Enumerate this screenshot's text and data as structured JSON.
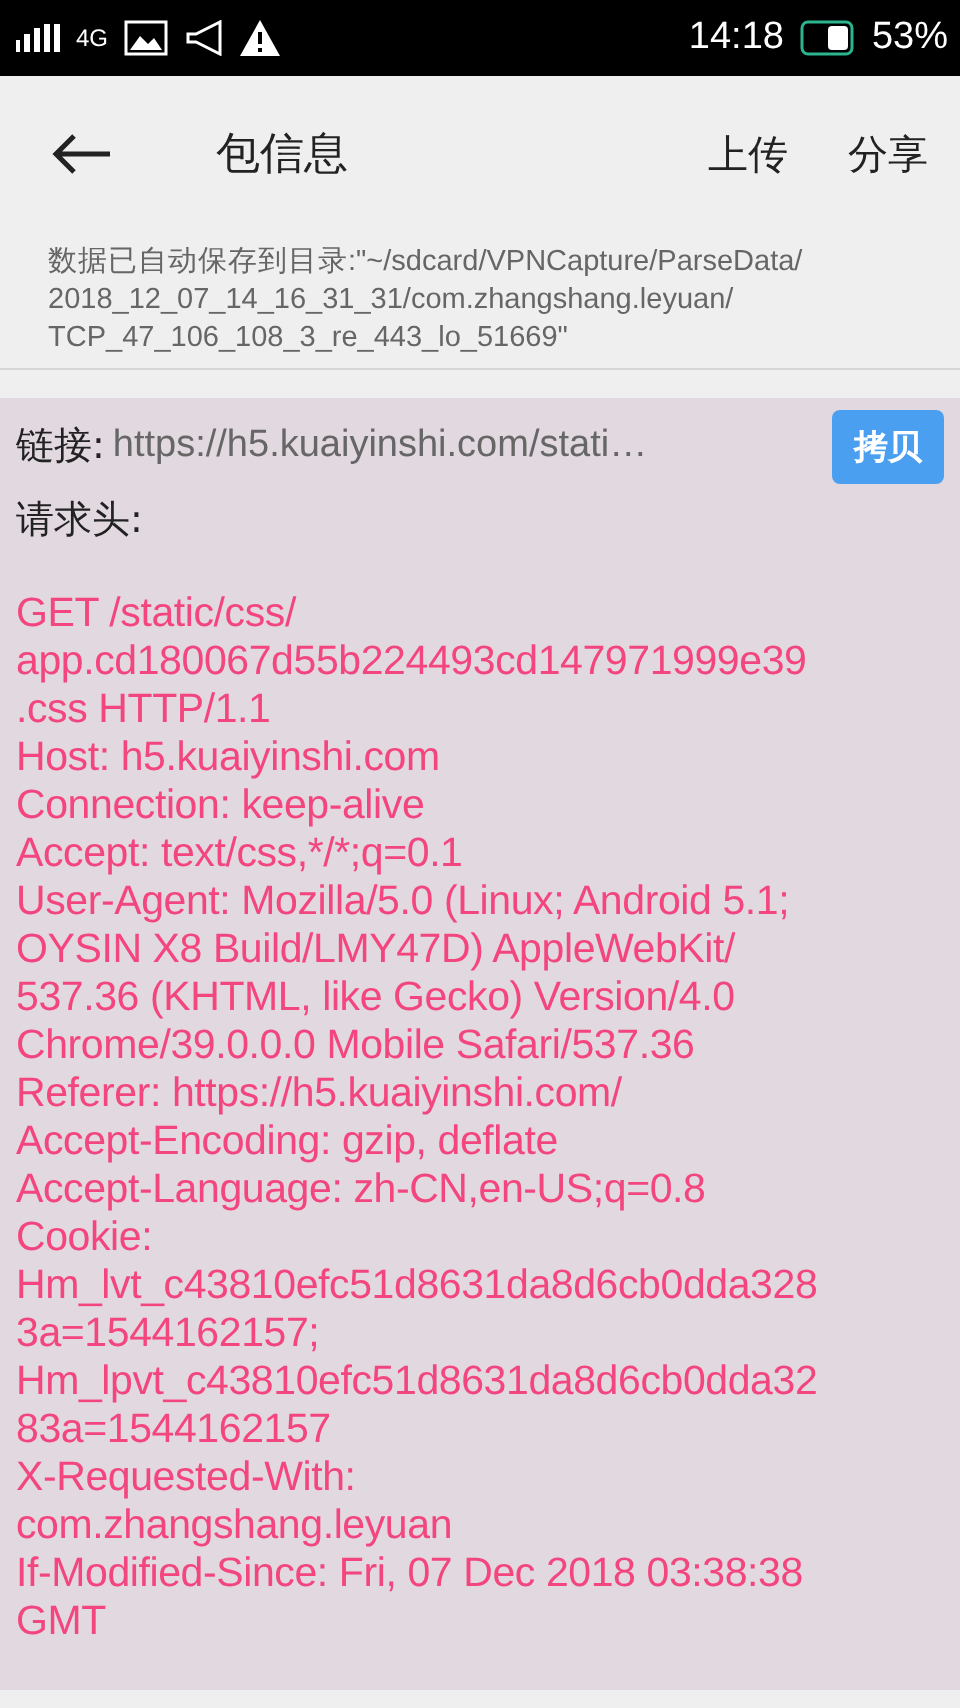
{
  "status_bar": {
    "network": "4G",
    "time": "14:18",
    "battery": "53%"
  },
  "toolbar": {
    "title": "包信息",
    "actions": [
      "上传",
      "分享"
    ]
  },
  "save_notice": [
    "数据已自动保存到目录:\"~/sdcard/VPNCapture/ParseData/",
    "2018_12_07_14_16_31_31/com.zhangshang.leyuan/",
    "TCP_47_106_108_3_re_443_lo_51669\""
  ],
  "link": {
    "label": "链接:",
    "url": "https://h5.kuaiyinshi.com/stati…",
    "button": "拷贝"
  },
  "headers_label": "请求头:",
  "headers": [
    "GET /static/css/",
    "app.cd180067d55b224493cd147971999e39",
    ".css HTTP/1.1",
    "Host: h5.kuaiyinshi.com",
    "Connection: keep-alive",
    "Accept: text/css,*/*;q=0.1",
    "User-Agent: Mozilla/5.0 (Linux; Android 5.1;",
    "OYSIN X8 Build/LMY47D) AppleWebKit/",
    "537.36 (KHTML, like Gecko) Version/4.0",
    "Chrome/39.0.0.0 Mobile Safari/537.36",
    "Referer: https://h5.kuaiyinshi.com/",
    "Accept-Encoding: gzip, deflate",
    "Accept-Language: zh-CN,en-US;q=0.8",
    "Cookie:",
    "Hm_lvt_c43810efc51d8631da8d6cb0dda328",
    "3a=1544162157;",
    "Hm_lpvt_c43810efc51d8631da8d6cb0dda32",
    "83a=1544162157",
    "X-Requested-With:",
    "com.zhangshang.leyuan",
    "If-Modified-Since: Fri, 07 Dec 2018 03:38:38",
    "GMT"
  ]
}
